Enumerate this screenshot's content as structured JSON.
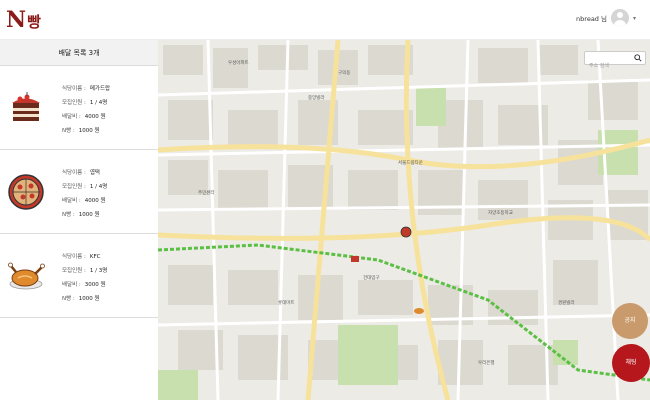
{
  "header": {
    "logo_n": "N",
    "logo_rest": "빵",
    "user_name": "nbread 님",
    "user_chevron": "▾"
  },
  "sidebar": {
    "title": "배달 목록 3개",
    "cards": [
      {
        "icon": "cake-icon",
        "restaurant_label": "식당이름 :",
        "restaurant": "메가드랍",
        "members_label": "모집인원 :",
        "members": "1 / 4명",
        "fee_label": "배달비 :",
        "fee": "4000 원",
        "per_person_label": "N빵 :",
        "per_person": "1000 원"
      },
      {
        "icon": "pizza-icon",
        "restaurant_label": "식당이름 :",
        "restaurant": "엽떡",
        "members_label": "모집인원 :",
        "members": "1 / 4명",
        "fee_label": "배달비 :",
        "fee": "4000 원",
        "per_person_label": "N빵 :",
        "per_person": "1000 원"
      },
      {
        "icon": "chicken-icon",
        "restaurant_label": "식당이름 :",
        "restaurant": "KFC",
        "members_label": "모집인원 :",
        "members": "1 / 3명",
        "fee_label": "배달비 :",
        "fee": "3000 원",
        "per_person_label": "N빵 :",
        "per_person": "1000 원"
      }
    ]
  },
  "map": {
    "search_placeholder": "주소 검색",
    "notice_button": "공지",
    "chat_button": "채팅",
    "labels": [
      "우성아파트",
      "중앙빌라",
      "서울드림타운",
      "구의동",
      "주민센터",
      "자양초등학교",
      "건대입구",
      "롯데마트",
      "우리은행",
      "경원빌라"
    ],
    "colors": {
      "road": "#ffffff",
      "major_road": "#f7e29c",
      "park": "#c8dfae",
      "subway": "#5bbf44",
      "building": "#dcd9d0"
    }
  }
}
